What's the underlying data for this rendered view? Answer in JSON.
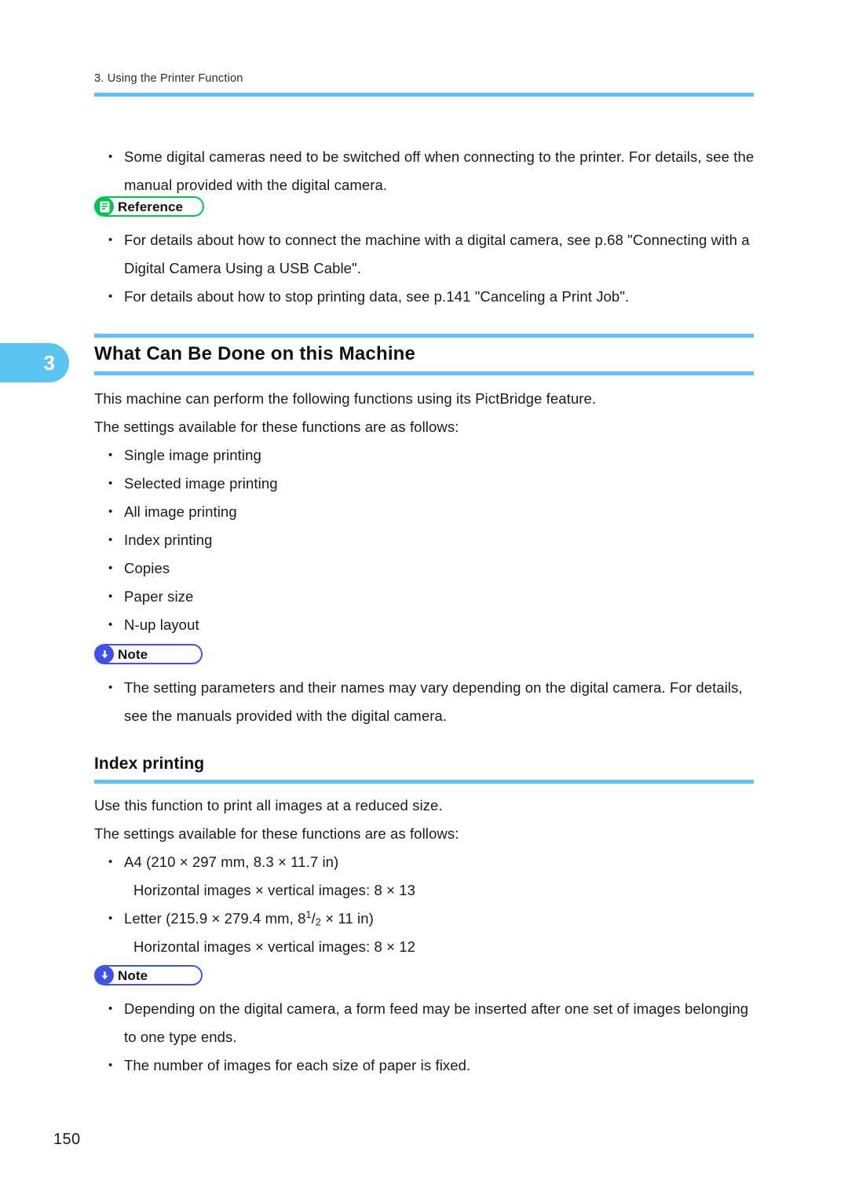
{
  "header": {
    "running_head": "3. Using the Printer Function",
    "rule_color": "#5bc5f2"
  },
  "chapter_tab": {
    "number": "3",
    "color": "#5bc5f2"
  },
  "top_notes": {
    "bullets": [
      "Some digital cameras need to be switched off when connecting to the printer. For details, see the manual provided with the digital camera."
    ]
  },
  "reference_callout": {
    "label": "Reference",
    "icon": "reference-book-icon",
    "color": "#00c44f",
    "bullets": [
      "For details about how to connect the machine with a digital camera, see p.68 \"Connecting with a Digital Camera Using a USB Cable\".",
      "For details about how to stop printing data, see p.141 \"Canceling a Print Job\"."
    ]
  },
  "section": {
    "title": "What Can Be Done on this Machine",
    "paragraphs": [
      "This machine can perform the following functions using its PictBridge feature.",
      "The settings available for these functions are as follows:"
    ],
    "features": [
      "Single image printing",
      "Selected image printing",
      "All image printing",
      "Index printing",
      "Copies",
      "Paper size",
      "N-up layout"
    ]
  },
  "note_callout_1": {
    "label": "Note",
    "icon": "note-down-arrow-icon",
    "color": "#3f51e8",
    "bullets": [
      "The setting parameters and their names may vary depending on the digital camera. For details, see the manuals provided with the digital camera."
    ]
  },
  "subsection": {
    "title": "Index printing",
    "paragraphs": [
      "Use this function to print all images at a reduced size.",
      "The settings available for these functions are as follows:"
    ],
    "paper_sizes": [
      {
        "size_line_prefix": "A4 (210 × 297 mm, 8.3 × 11.7 in)",
        "has_fraction": false,
        "detail": "Horizontal images × vertical images: 8 × 13"
      },
      {
        "size_line_prefix": "Letter (215.9 × 279.4 mm, 8",
        "has_fraction": true,
        "fraction_numerator": "1",
        "fraction_denominator": "2",
        "size_line_suffix": " × 11 in)",
        "detail": "Horizontal images × vertical images: 8 × 12"
      }
    ]
  },
  "note_callout_2": {
    "label": "Note",
    "icon": "note-down-arrow-icon",
    "color": "#3f51e8",
    "bullets": [
      "Depending on the digital camera, a form feed may be inserted after one set of images belonging to one type ends.",
      "The number of images for each size of paper is fixed."
    ]
  },
  "footer": {
    "page_number": "150"
  }
}
